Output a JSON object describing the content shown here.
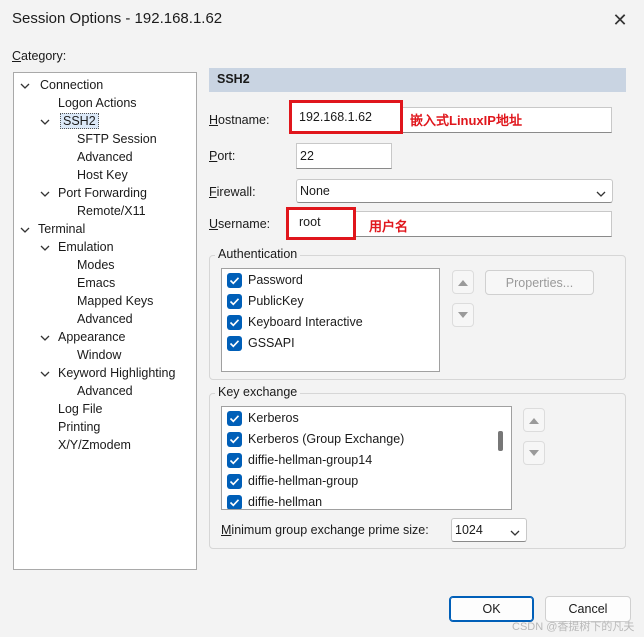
{
  "window": {
    "title": "Session Options - 192.168.1.62",
    "close_glyph": "✕"
  },
  "category_label": "Category:",
  "tree": [
    {
      "label": "Connection",
      "expanded": true
    },
    {
      "label": "Logon Actions"
    },
    {
      "label": "SSH2",
      "expanded": true,
      "selected": true
    },
    {
      "label": "SFTP Session"
    },
    {
      "label": "Advanced"
    },
    {
      "label": "Host Key"
    },
    {
      "label": "Port Forwarding",
      "expanded": true
    },
    {
      "label": "Remote/X11"
    },
    {
      "label": "Terminal",
      "expanded": true
    },
    {
      "label": "Emulation",
      "expanded": true
    },
    {
      "label": "Modes"
    },
    {
      "label": "Emacs"
    },
    {
      "label": "Mapped Keys"
    },
    {
      "label": "Advanced"
    },
    {
      "label": "Appearance",
      "expanded": true
    },
    {
      "label": "Window"
    },
    {
      "label": "Keyword Highlighting",
      "expanded": true
    },
    {
      "label": "Advanced"
    },
    {
      "label": "Log File"
    },
    {
      "label": "Printing"
    },
    {
      "label": "X/Y/Zmodem"
    }
  ],
  "panel": {
    "header": "SSH2",
    "hostname_label": "Hostname:",
    "hostname_value": "192.168.1.62",
    "hostname_note": "嵌入式LinuxIP地址",
    "port_label": "Port:",
    "port_value": "22",
    "firewall_label": "Firewall:",
    "firewall_value": "None",
    "username_label": "Username:",
    "username_value": "root",
    "username_note": "用户名"
  },
  "authentication": {
    "title": "Authentication",
    "items": [
      {
        "label": "Password",
        "checked": true
      },
      {
        "label": "PublicKey",
        "checked": true
      },
      {
        "label": "Keyboard Interactive",
        "checked": true
      },
      {
        "label": "GSSAPI",
        "checked": true
      }
    ],
    "properties_label": "Properties..."
  },
  "key_exchange": {
    "title": "Key exchange",
    "items": [
      {
        "label": "Kerberos",
        "checked": true
      },
      {
        "label": "Kerberos (Group Exchange)",
        "checked": true
      },
      {
        "label": "diffie-hellman-group14",
        "checked": true
      },
      {
        "label": "diffie-hellman-group",
        "checked": true
      },
      {
        "label": "diffie-hellman",
        "checked": true
      }
    ],
    "min_prime_label": "Minimum group exchange prime size:",
    "min_prime_value": "1024"
  },
  "buttons": {
    "ok": "OK",
    "cancel": "Cancel"
  },
  "watermark": "CSDN @香提树下的凡夫",
  "colors": {
    "accent": "#005fb8",
    "annotation": "#e0161c",
    "header": "#c9d4e2"
  }
}
